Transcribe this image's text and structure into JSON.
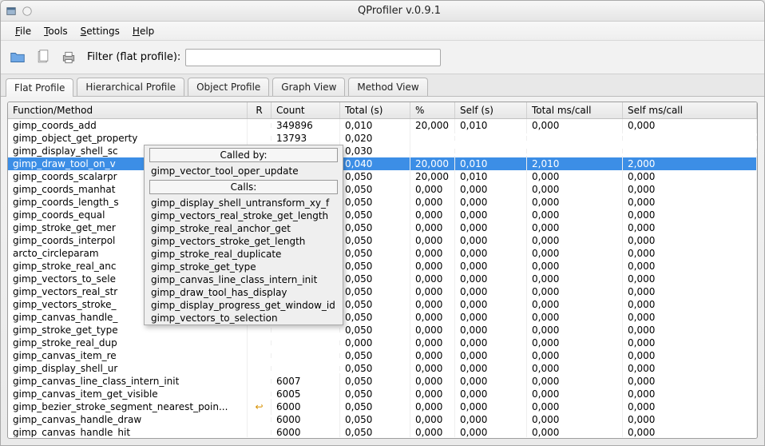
{
  "window": {
    "title": "QProfiler v.0.9.1"
  },
  "menubar": [
    {
      "label": "File",
      "u": 0
    },
    {
      "label": "Tools",
      "u": 0
    },
    {
      "label": "Settings",
      "u": 0
    },
    {
      "label": "Help",
      "u": 0
    }
  ],
  "toolbar": {
    "filter_label": "Filter (flat profile):",
    "filter_value": ""
  },
  "tabs": [
    {
      "label": "Flat Profile",
      "active": true
    },
    {
      "label": "Hierarchical Profile",
      "active": false
    },
    {
      "label": "Object Profile",
      "active": false
    },
    {
      "label": "Graph View",
      "active": false
    },
    {
      "label": "Method View",
      "active": false
    }
  ],
  "columns": [
    "Function/Method",
    "R",
    "Count",
    "Total (s)",
    "%",
    "Self (s)",
    "Total ms/call",
    "Self ms/call"
  ],
  "rows": [
    {
      "fn": "gimp_coords_add",
      "r": "",
      "count": "349896",
      "total": "0,010",
      "pct": "20,000",
      "self": "0,010",
      "tmc": "0,000",
      "smc": "0,000",
      "sel": false
    },
    {
      "fn": "gimp_object_get_property",
      "r": "",
      "count": "13793",
      "total": "0,020",
      "pct": "",
      "self": "",
      "tmc": "",
      "smc": "",
      "sel": false
    },
    {
      "fn": "gimp_display_shell_sc",
      "r": "",
      "count": "",
      "total": "0,030",
      "pct": "",
      "self": "",
      "tmc": "",
      "smc": "",
      "sel": false
    },
    {
      "fn": "gimp_draw_tool_on_v",
      "r": "",
      "count": "",
      "total": "0,040",
      "pct": "20,000",
      "self": "0,010",
      "tmc": "2,010",
      "smc": "2,000",
      "sel": true
    },
    {
      "fn": "gimp_coords_scalarpr",
      "r": "",
      "count": "",
      "total": "0,050",
      "pct": "20,000",
      "self": "0,010",
      "tmc": "0,000",
      "smc": "0,000",
      "sel": false
    },
    {
      "fn": "gimp_coords_manhat",
      "r": "",
      "count": "",
      "total": "0,050",
      "pct": "0,000",
      "self": "0,000",
      "tmc": "0,000",
      "smc": "0,000",
      "sel": false
    },
    {
      "fn": "gimp_coords_length_s",
      "r": "",
      "count": "",
      "total": "0,050",
      "pct": "0,000",
      "self": "0,000",
      "tmc": "0,000",
      "smc": "0,000",
      "sel": false
    },
    {
      "fn": "gimp_coords_equal",
      "r": "",
      "count": "",
      "total": "0,050",
      "pct": "0,000",
      "self": "0,000",
      "tmc": "0,000",
      "smc": "0,000",
      "sel": false
    },
    {
      "fn": "gimp_stroke_get_mer",
      "r": "",
      "count": "",
      "total": "0,050",
      "pct": "0,000",
      "self": "0,000",
      "tmc": "0,000",
      "smc": "0,000",
      "sel": false
    },
    {
      "fn": "gimp_coords_interpol",
      "r": "",
      "count": "",
      "total": "0,050",
      "pct": "0,000",
      "self": "0,000",
      "tmc": "0,000",
      "smc": "0,000",
      "sel": false
    },
    {
      "fn": "arcto_circleparam",
      "r": "",
      "count": "",
      "total": "0,050",
      "pct": "0,000",
      "self": "0,000",
      "tmc": "0,000",
      "smc": "0,000",
      "sel": false
    },
    {
      "fn": "gimp_stroke_real_anc",
      "r": "",
      "count": "",
      "total": "0,050",
      "pct": "0,000",
      "self": "0,000",
      "tmc": "0,000",
      "smc": "0,000",
      "sel": false
    },
    {
      "fn": "gimp_vectors_to_sele",
      "r": "",
      "count": "",
      "total": "0,050",
      "pct": "0,000",
      "self": "0,000",
      "tmc": "0,000",
      "smc": "0,000",
      "sel": false
    },
    {
      "fn": "gimp_vectors_real_str",
      "r": "",
      "count": "",
      "total": "0,050",
      "pct": "0,000",
      "self": "0,000",
      "tmc": "0,000",
      "smc": "0,000",
      "sel": false
    },
    {
      "fn": "gimp_vectors_stroke_",
      "r": "",
      "count": "",
      "total": "0,050",
      "pct": "0,000",
      "self": "0,000",
      "tmc": "0,000",
      "smc": "0,000",
      "sel": false
    },
    {
      "fn": "gimp_canvas_handle_",
      "r": "",
      "count": "",
      "total": "0,050",
      "pct": "0,000",
      "self": "0,000",
      "tmc": "0,000",
      "smc": "0,000",
      "sel": false
    },
    {
      "fn": "gimp_stroke_get_type",
      "r": "",
      "count": "",
      "total": "0,050",
      "pct": "0,000",
      "self": "0,000",
      "tmc": "0,000",
      "smc": "0,000",
      "sel": false
    },
    {
      "fn": "gimp_stroke_real_dup",
      "r": "",
      "count": "",
      "total": "0,000",
      "pct": "0,000",
      "self": "0,000",
      "tmc": "0,000",
      "smc": "0,000",
      "sel": false
    },
    {
      "fn": "gimp_canvas_item_re",
      "r": "",
      "count": "",
      "total": "0,050",
      "pct": "0,000",
      "self": "0,000",
      "tmc": "0,000",
      "smc": "0,000",
      "sel": false
    },
    {
      "fn": "gimp_display_shell_ur",
      "r": "",
      "count": "",
      "total": "0,050",
      "pct": "0,000",
      "self": "0,000",
      "tmc": "0,000",
      "smc": "0,000",
      "sel": false
    },
    {
      "fn": "gimp_canvas_line_class_intern_init",
      "r": "",
      "count": "6007",
      "total": "0,050",
      "pct": "0,000",
      "self": "0,000",
      "tmc": "0,000",
      "smc": "0,000",
      "sel": false
    },
    {
      "fn": "gimp_canvas_item_get_visible",
      "r": "",
      "count": "6005",
      "total": "0,050",
      "pct": "0,000",
      "self": "0,000",
      "tmc": "0,000",
      "smc": "0,000",
      "sel": false
    },
    {
      "fn": "gimp_bezier_stroke_segment_nearest_poin...",
      "r": "↩",
      "count": "6000",
      "total": "0,050",
      "pct": "0,000",
      "self": "0,000",
      "tmc": "0,000",
      "smc": "0,000",
      "sel": false
    },
    {
      "fn": "gimp_canvas_handle_draw",
      "r": "",
      "count": "6000",
      "total": "0,050",
      "pct": "0,000",
      "self": "0,000",
      "tmc": "0,000",
      "smc": "0,000",
      "sel": false
    },
    {
      "fn": "gimp_canvas_handle_hit",
      "r": "",
      "count": "6000",
      "total": "0,050",
      "pct": "0,000",
      "self": "0,000",
      "tmc": "0,000",
      "smc": "0,000",
      "sel": false
    }
  ],
  "popup": {
    "called_by_header": "Called by:",
    "called_by": [
      "gimp_vector_tool_oper_update"
    ],
    "calls_header": "Calls:",
    "calls": [
      "gimp_display_shell_untransform_xy_f",
      "gimp_vectors_real_stroke_get_length",
      "gimp_stroke_real_anchor_get",
      "gimp_vectors_stroke_get_length",
      "gimp_stroke_real_duplicate",
      "gimp_stroke_get_type",
      "gimp_canvas_line_class_intern_init",
      "gimp_draw_tool_has_display",
      "gimp_display_progress_get_window_id",
      "gimp_vectors_to_selection"
    ]
  }
}
